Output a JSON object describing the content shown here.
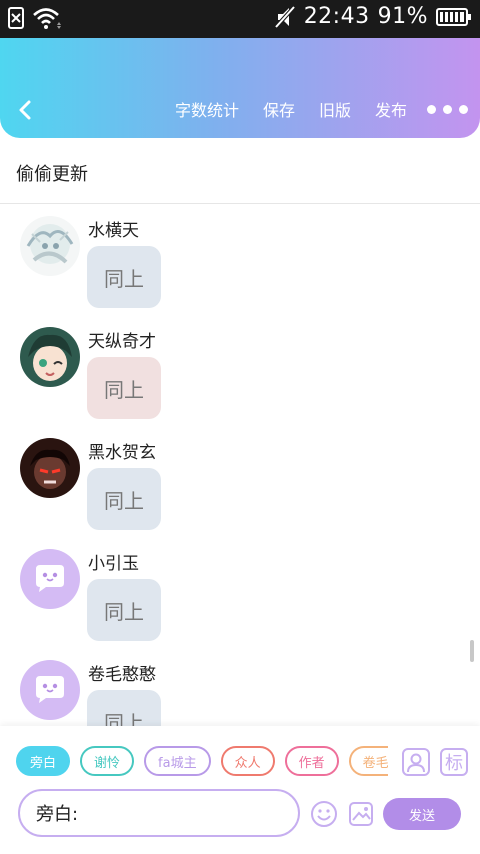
{
  "status_bar": {
    "time": "22:43",
    "battery": "91%"
  },
  "header": {
    "actions": [
      {
        "label": "字数统计"
      },
      {
        "label": "保存"
      },
      {
        "label": "旧版"
      },
      {
        "label": "发布"
      }
    ]
  },
  "page": {
    "title": "偷偷更新"
  },
  "messages": [
    {
      "sender": "水横天",
      "text": "同上",
      "bubble_color": "#dfe6ee"
    },
    {
      "sender": "天纵奇才",
      "text": "同上",
      "bubble_color": "#f1e0e0"
    },
    {
      "sender": "黑水贺玄",
      "text": "同上",
      "bubble_color": "#dfe6ee"
    },
    {
      "sender": "小引玉",
      "text": "同上",
      "bubble_color": "#dfe6ee"
    },
    {
      "sender": "卷毛憨憨",
      "text": "同上",
      "bubble_color": "#dfe6ee"
    }
  ],
  "bottom_bar": {
    "roles": [
      {
        "label": "旁白",
        "color": "#4fd4ee",
        "active": true
      },
      {
        "label": "谢怜",
        "color": "#46c8c0",
        "active": false
      },
      {
        "label": "fa城主",
        "color": "#b89ae8",
        "active": false
      },
      {
        "label": "众人",
        "color": "#ef7a6e",
        "active": false
      },
      {
        "label": "作者",
        "color": "#ee6f9a",
        "active": false
      },
      {
        "label": "卷毛",
        "color": "#f4b27a",
        "active": false
      }
    ],
    "mark_button_label": "标",
    "input_value": "旁白:",
    "send_label": "发送"
  },
  "colors": {
    "header_gradient_start": "#4fd6f0",
    "header_gradient_end": "#c394ef",
    "accent_purple": "#b28de8",
    "default_avatar": "#d4bbf4"
  },
  "icons": {
    "back": "chevron-left-icon",
    "more": "more-dots-icon",
    "profile": "person-icon",
    "emoji": "smiley-icon",
    "image": "image-icon"
  }
}
